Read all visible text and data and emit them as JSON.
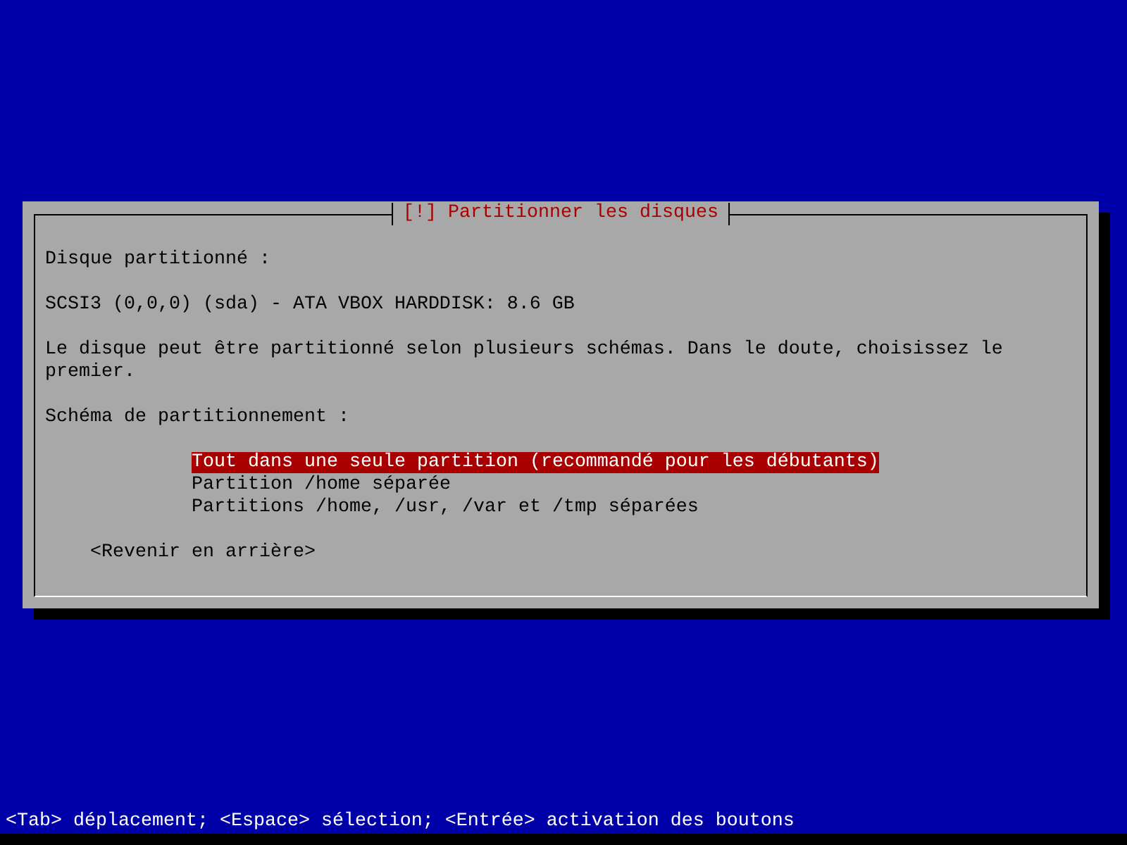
{
  "dialog": {
    "title": "[!] Partitionner les disques",
    "disk_label": "Disque partitionné :",
    "disk": "SCSI3 (0,0,0) (sda) - ATA VBOX HARDDISK: 8.6 GB",
    "description": "Le disque peut être partitionné selon plusieurs schémas. Dans le doute, choisissez le premier.",
    "scheme_label": "Schéma de partitionnement :",
    "options": [
      {
        "label": "Tout dans une seule partition (recommandé pour les débutants)",
        "selected": true
      },
      {
        "label": "Partition /home séparée",
        "selected": false
      },
      {
        "label": "Partitions /home, /usr, /var et /tmp séparées",
        "selected": false
      }
    ],
    "back_button": "<Revenir en arrière>"
  },
  "status_bar": "<Tab> déplacement; <Espace> sélection; <Entrée> activation des boutons"
}
